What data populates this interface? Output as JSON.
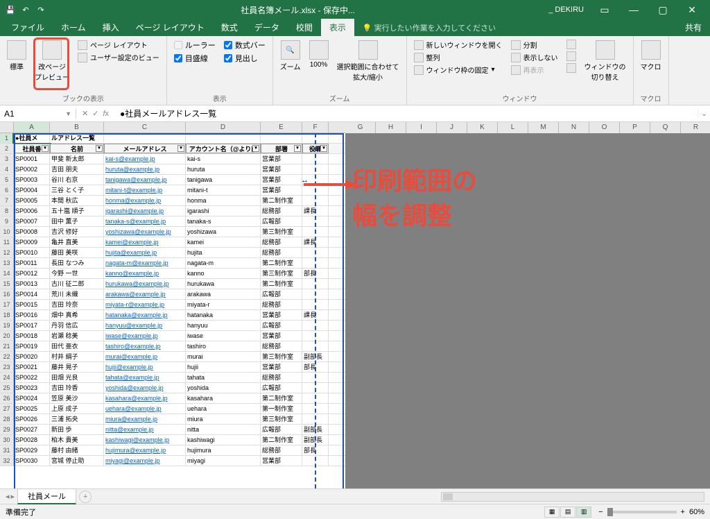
{
  "titlebar": {
    "filename": "社員名簿メール.xlsx - 保存中...",
    "user": "_ DEKIRU"
  },
  "tabs": {
    "file": "ファイル",
    "home": "ホーム",
    "insert": "挿入",
    "pagelayout": "ページ レイアウト",
    "formulas": "数式",
    "data": "データ",
    "review": "校閲",
    "view": "表示",
    "tellme": "実行したい作業を入力してください",
    "share": "共有"
  },
  "ribbon": {
    "g1": {
      "normal": "標準",
      "pagebreak": "改ページ\nプレビュー",
      "pagelayout": "ページ レイアウト",
      "custom": "ユーザー設定のビュー",
      "label": "ブックの表示"
    },
    "g2": {
      "ruler": "ルーラー",
      "formulabar": "数式バー",
      "gridlines": "目盛線",
      "headings": "見出し",
      "label": "表示"
    },
    "g3": {
      "zoom": "ズーム",
      "z100": "100%",
      "zoomsel": "選択範囲に合わせて\n拡大/縮小",
      "label": "ズーム"
    },
    "g4": {
      "newwin": "新しいウィンドウを開く",
      "arrange": "整列",
      "freeze": "ウィンドウ枠の固定",
      "split": "分割",
      "hide": "表示しない",
      "unhide": "再表示",
      "switch": "ウィンドウの\n切り替え",
      "label": "ウィンドウ"
    },
    "g5": {
      "macros": "マクロ",
      "label": "マクロ"
    }
  },
  "namebox": "A1",
  "formula": "●社員メールアドレス一覧",
  "cols": [
    "A",
    "B",
    "C",
    "D",
    "E",
    "F",
    "G",
    "H",
    "I",
    "J",
    "K",
    "L",
    "M",
    "N",
    "O",
    "P",
    "Q",
    "R"
  ],
  "titlecell_a": "●社員メ",
  "titlecell_b": "ルアドレス一覧",
  "headers": [
    "社員番",
    "名前",
    "メールアドレス",
    "アカウント名（@より前",
    "部署",
    "役職"
  ],
  "rows": [
    [
      "SP0001",
      "甲斐 新太郎",
      "kai-s@example.jp",
      "kai-s",
      "営業部",
      ""
    ],
    [
      "SP0002",
      "吉田 朋夫",
      "huruta@example.jp",
      "huruta",
      "営業部",
      ""
    ],
    [
      "SP0003",
      "谷川 右京",
      "tanigawa@example.jp",
      "tanigawa",
      "営業部",
      ""
    ],
    [
      "SP0004",
      "三谷 とく子",
      "mitani-t@example.jp",
      "mitani-t",
      "営業部",
      ""
    ],
    [
      "SP0005",
      "本間 秋広",
      "honma@example.jp",
      "honma",
      "第二制作室",
      ""
    ],
    [
      "SP0006",
      "五十嵐 順子",
      "igarashi@example.jp",
      "igarashi",
      "総務部",
      "課長"
    ],
    [
      "SP0007",
      "田中 薫子",
      "tanaka-s@example.jp",
      "tanaka-s",
      "広報部",
      ""
    ],
    [
      "SP0008",
      "吉沢 修好",
      "yoshizawa@example.jp",
      "yoshizawa",
      "第三制作室",
      ""
    ],
    [
      "SP0009",
      "亀井 直美",
      "kamei@example.jp",
      "kamei",
      "総務部",
      "課長"
    ],
    [
      "SP0010",
      "藤田 美咲",
      "hujita@example.jp",
      "hujita",
      "総務部",
      ""
    ],
    [
      "SP0011",
      "長田 なつみ",
      "nagata-m@example.jp",
      "nagata-m",
      "第二制作室",
      ""
    ],
    [
      "SP0012",
      "今野 一世",
      "kanno@example.jp",
      "kanno",
      "第三制作室",
      "部長"
    ],
    [
      "SP0013",
      "古川 征二郎",
      "hurukawa@example.jp",
      "hurukawa",
      "第二制作室",
      ""
    ],
    [
      "SP0014",
      "荒川 未織",
      "arakawa@example.jp",
      "arakawa",
      "広報部",
      ""
    ],
    [
      "SP0015",
      "吉田 玲奈",
      "miyata-r@example.jp",
      "miyata-r",
      "総務部",
      ""
    ],
    [
      "SP0016",
      "畑中 真希",
      "hatanaka@example.jp",
      "hatanaka",
      "営業部",
      "課長"
    ],
    [
      "SP0017",
      "丹羽 信広",
      "hanyuu@example.jp",
      "hanyuu",
      "広報部",
      ""
    ],
    [
      "SP0018",
      "岩瀬 稔美",
      "iwase@example.jp",
      "iwase",
      "営業部",
      ""
    ],
    [
      "SP0019",
      "田代 亜衣",
      "tashiro@example.jp",
      "tashiro",
      "総務部",
      ""
    ],
    [
      "SP0020",
      "村井 絹子",
      "murai@example.jp",
      "murai",
      "第三制作室",
      "副部長"
    ],
    [
      "SP0021",
      "藤井 晃子",
      "hujii@example.jp",
      "hujii",
      "営業部",
      "部長"
    ],
    [
      "SP0022",
      "田畑 光良",
      "tahata@example.jp",
      "tahata",
      "総務部",
      ""
    ],
    [
      "SP0023",
      "吉田 玲香",
      "yoshida@example.jp",
      "yoshida",
      "広報部",
      ""
    ],
    [
      "SP0024",
      "笠原 美沙",
      "kasahara@example.jp",
      "kasahara",
      "第二制作室",
      ""
    ],
    [
      "SP0025",
      "上原 成子",
      "uehara@example.jp",
      "uehara",
      "第一制作室",
      ""
    ],
    [
      "SP0026",
      "三浦 拓央",
      "miura@example.jp",
      "miura",
      "第三制作室",
      ""
    ],
    [
      "SP0027",
      "新田 歩",
      "nitta@example.jp",
      "nitta",
      "広報部",
      "副部長"
    ],
    [
      "SP0028",
      "柏木 貴美",
      "kashiwagi@example.jp",
      "kashiwagi",
      "第二制作室",
      "副部長"
    ],
    [
      "SP0029",
      "藤村 由緒",
      "hujimura@example.jp",
      "hujimura",
      "総務部",
      "部長"
    ],
    [
      "SP0030",
      "宮城 停止助",
      "miyagi@example.jp",
      "miyagi",
      "営業部",
      ""
    ]
  ],
  "sheettab": "社員メール",
  "status": "準備完了",
  "zoom": "60%",
  "overlay": {
    "line1": "印刷範囲の",
    "line2": "幅を調整"
  }
}
